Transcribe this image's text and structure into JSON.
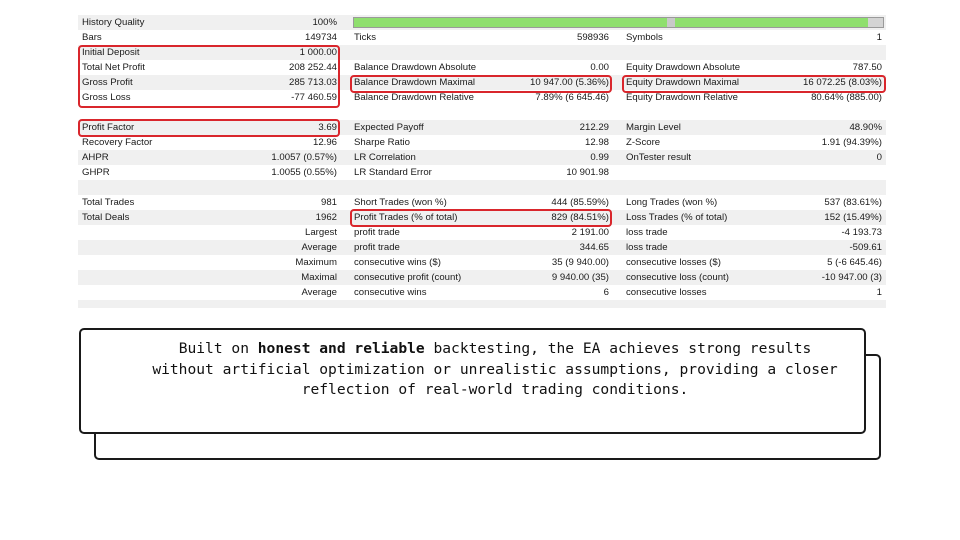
{
  "report": {
    "history_quality": {
      "label": "History Quality",
      "value": "100%"
    },
    "row_bars": {
      "c1l": "Bars",
      "c1v": "149734",
      "c2l": "Ticks",
      "c2v": "598936",
      "c3l": "Symbols",
      "c3v": "1"
    },
    "row_deposit": {
      "c1l": "Initial Deposit",
      "c1v": "1 000.00",
      "c2l": "Balance Drawdown Absolute",
      "c2v": "0.00",
      "c3l": "Equity Drawdown Absolute",
      "c3v": "787.50"
    },
    "row_netprofit": {
      "c1l": "Total Net Profit",
      "c1v": "208 252.44",
      "c2l": "Balance Drawdown Absolute",
      "c2v": "0.00",
      "c3l": "Equity Drawdown Absolute",
      "c3v": "787.50"
    },
    "row_grossprofit": {
      "c1l": "Gross Profit",
      "c1v": "285 713.03",
      "c2l": "Balance Drawdown Maximal",
      "c2v": "10 947.00 (5.36%)",
      "c3l": "Equity Drawdown Maximal",
      "c3v": "16 072.25 (8.03%)"
    },
    "row_grossloss": {
      "c1l": "Gross Loss",
      "c1v": "-77 460.59",
      "c2l": "Balance Drawdown Relative",
      "c2v": "7.89% (6 645.46)",
      "c3l": "Equity Drawdown Relative",
      "c3v": "80.64% (885.00)"
    },
    "row_pf": {
      "c1l": "Profit Factor",
      "c1v": "3.69",
      "c2l": "Expected Payoff",
      "c2v": "212.29",
      "c3l": "Margin Level",
      "c3v": "48.90%"
    },
    "row_rf": {
      "c1l": "Recovery Factor",
      "c1v": "12.96",
      "c2l": "Sharpe Ratio",
      "c2v": "12.98",
      "c3l": "Z-Score",
      "c3v": "1.91 (94.39%)"
    },
    "row_ahpr": {
      "c1l": "AHPR",
      "c1v": "1.0057 (0.57%)",
      "c2l": "LR Correlation",
      "c2v": "0.99",
      "c3l": "OnTester result",
      "c3v": "0"
    },
    "row_ghpr": {
      "c1l": "GHPR",
      "c1v": "1.0055 (0.55%)",
      "c2l": "LR Standard Error",
      "c2v": "10 901.98",
      "c3l": "",
      "c3v": ""
    },
    "row_trades": {
      "c1l": "Total Trades",
      "c1v": "981",
      "c2l": "Short Trades (won %)",
      "c2v": "444 (85.59%)",
      "c3l": "Long Trades (won %)",
      "c3v": "537 (83.61%)"
    },
    "row_deals": {
      "c1l": "Total Deals",
      "c1v": "1962",
      "c2l": "Profit Trades (% of total)",
      "c2v": "829 (84.51%)",
      "c3l": "Loss Trades (% of total)",
      "c3v": "152 (15.49%)"
    },
    "row_largest": {
      "c1l": "",
      "c1v": "Largest",
      "c2l": "profit trade",
      "c2v": "2 191.00",
      "c3l": "loss trade",
      "c3v": "-4 193.73"
    },
    "row_average": {
      "c1l": "",
      "c1v": "Average",
      "c2l": "profit trade",
      "c2v": "344.65",
      "c3l": "loss trade",
      "c3v": "-509.61"
    },
    "row_maximum": {
      "c1l": "",
      "c1v": "Maximum",
      "c2l": "consecutive wins ($)",
      "c2v": "35 (9 940.00)",
      "c3l": "consecutive losses ($)",
      "c3v": "5 (-6 645.46)"
    },
    "row_maximal": {
      "c1l": "",
      "c1v": "Maximal",
      "c2l": "consecutive profit (count)",
      "c2v": "9 940.00 (35)",
      "c3l": "consecutive loss (count)",
      "c3v": "-10 947.00 (3)"
    },
    "row_average2": {
      "c1l": "",
      "c1v": "Average",
      "c2l": "consecutive wins",
      "c2v": "6",
      "c3l": "consecutive losses",
      "c3v": "1"
    }
  },
  "history_quality_bar": {
    "fill_fraction": 1.0,
    "fill_color": "#8fdf6e"
  },
  "highlight_color": "#d9262c",
  "callout": {
    "text_before": "Built on ",
    "text_bold": "honest and reliable",
    "text_after": " backtesting, the EA achieves strong results without artificial optimization or unrealistic assumptions, providing a closer reflection of real-world trading conditions."
  }
}
